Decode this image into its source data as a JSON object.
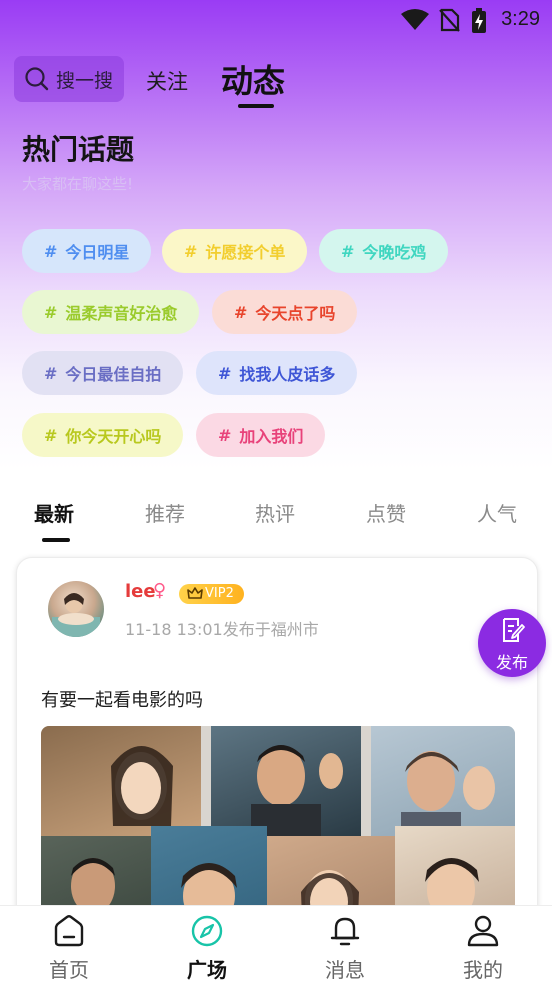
{
  "status_bar": {
    "time": "3:29",
    "icons": [
      "wifi-icon",
      "no-sim-icon",
      "battery-charging-icon"
    ]
  },
  "header": {
    "search_placeholder": "搜一搜",
    "tabs": [
      {
        "label": "关注",
        "active": false
      },
      {
        "label": "动态",
        "active": true
      }
    ]
  },
  "hot_topics": {
    "title": "热门话题",
    "subtitle": "大家都在聊这些!",
    "tags": [
      {
        "label": "今日明星",
        "color": "#4f8ef0",
        "bg": "#d6e6fb"
      },
      {
        "label": "许愿接个单",
        "color": "#f2ce2e",
        "bg": "#fbf7c8"
      },
      {
        "label": "今晚吃鸡",
        "color": "#3fd6c0",
        "bg": "#d4f6ee"
      },
      {
        "label": "温柔声音好治愈",
        "color": "#9acb2c",
        "bg": "#e9f7d2"
      },
      {
        "label": "今天点了吗",
        "color": "#e8442c",
        "bg": "#fbdcd6"
      },
      {
        "label": "今日最佳自拍",
        "color": "#6a6ec4",
        "bg": "#e2e1f3"
      },
      {
        "label": "找我人皮话多",
        "color": "#3f56d6",
        "bg": "#dee4fb"
      },
      {
        "label": "你今天开心吗",
        "color": "#b8c81e",
        "bg": "#f6f8c8"
      },
      {
        "label": "加入我们",
        "color": "#e8427a",
        "bg": "#fbd9e4"
      }
    ]
  },
  "feed_tabs": [
    {
      "label": "最新",
      "active": true
    },
    {
      "label": "推荐",
      "active": false
    },
    {
      "label": "热评",
      "active": false
    },
    {
      "label": "点赞",
      "active": false
    },
    {
      "label": "人气",
      "active": false
    }
  ],
  "post": {
    "username": "lee",
    "gender_symbol": "♀",
    "vip": "VIP2",
    "meta": "11-18 13:01发布于福州市",
    "text": "有要一起看电影的吗"
  },
  "fab": {
    "label": "发布"
  },
  "bottom_nav": [
    {
      "label": "首页",
      "icon": "home-icon",
      "active": false
    },
    {
      "label": "广场",
      "icon": "compass-icon",
      "active": true
    },
    {
      "label": "消息",
      "icon": "bell-icon",
      "active": false
    },
    {
      "label": "我的",
      "icon": "user-icon",
      "active": false
    }
  ],
  "colors": {
    "accent": "#8b2be2",
    "active_nav": "#18c4a8",
    "username": "#e53b3b"
  }
}
